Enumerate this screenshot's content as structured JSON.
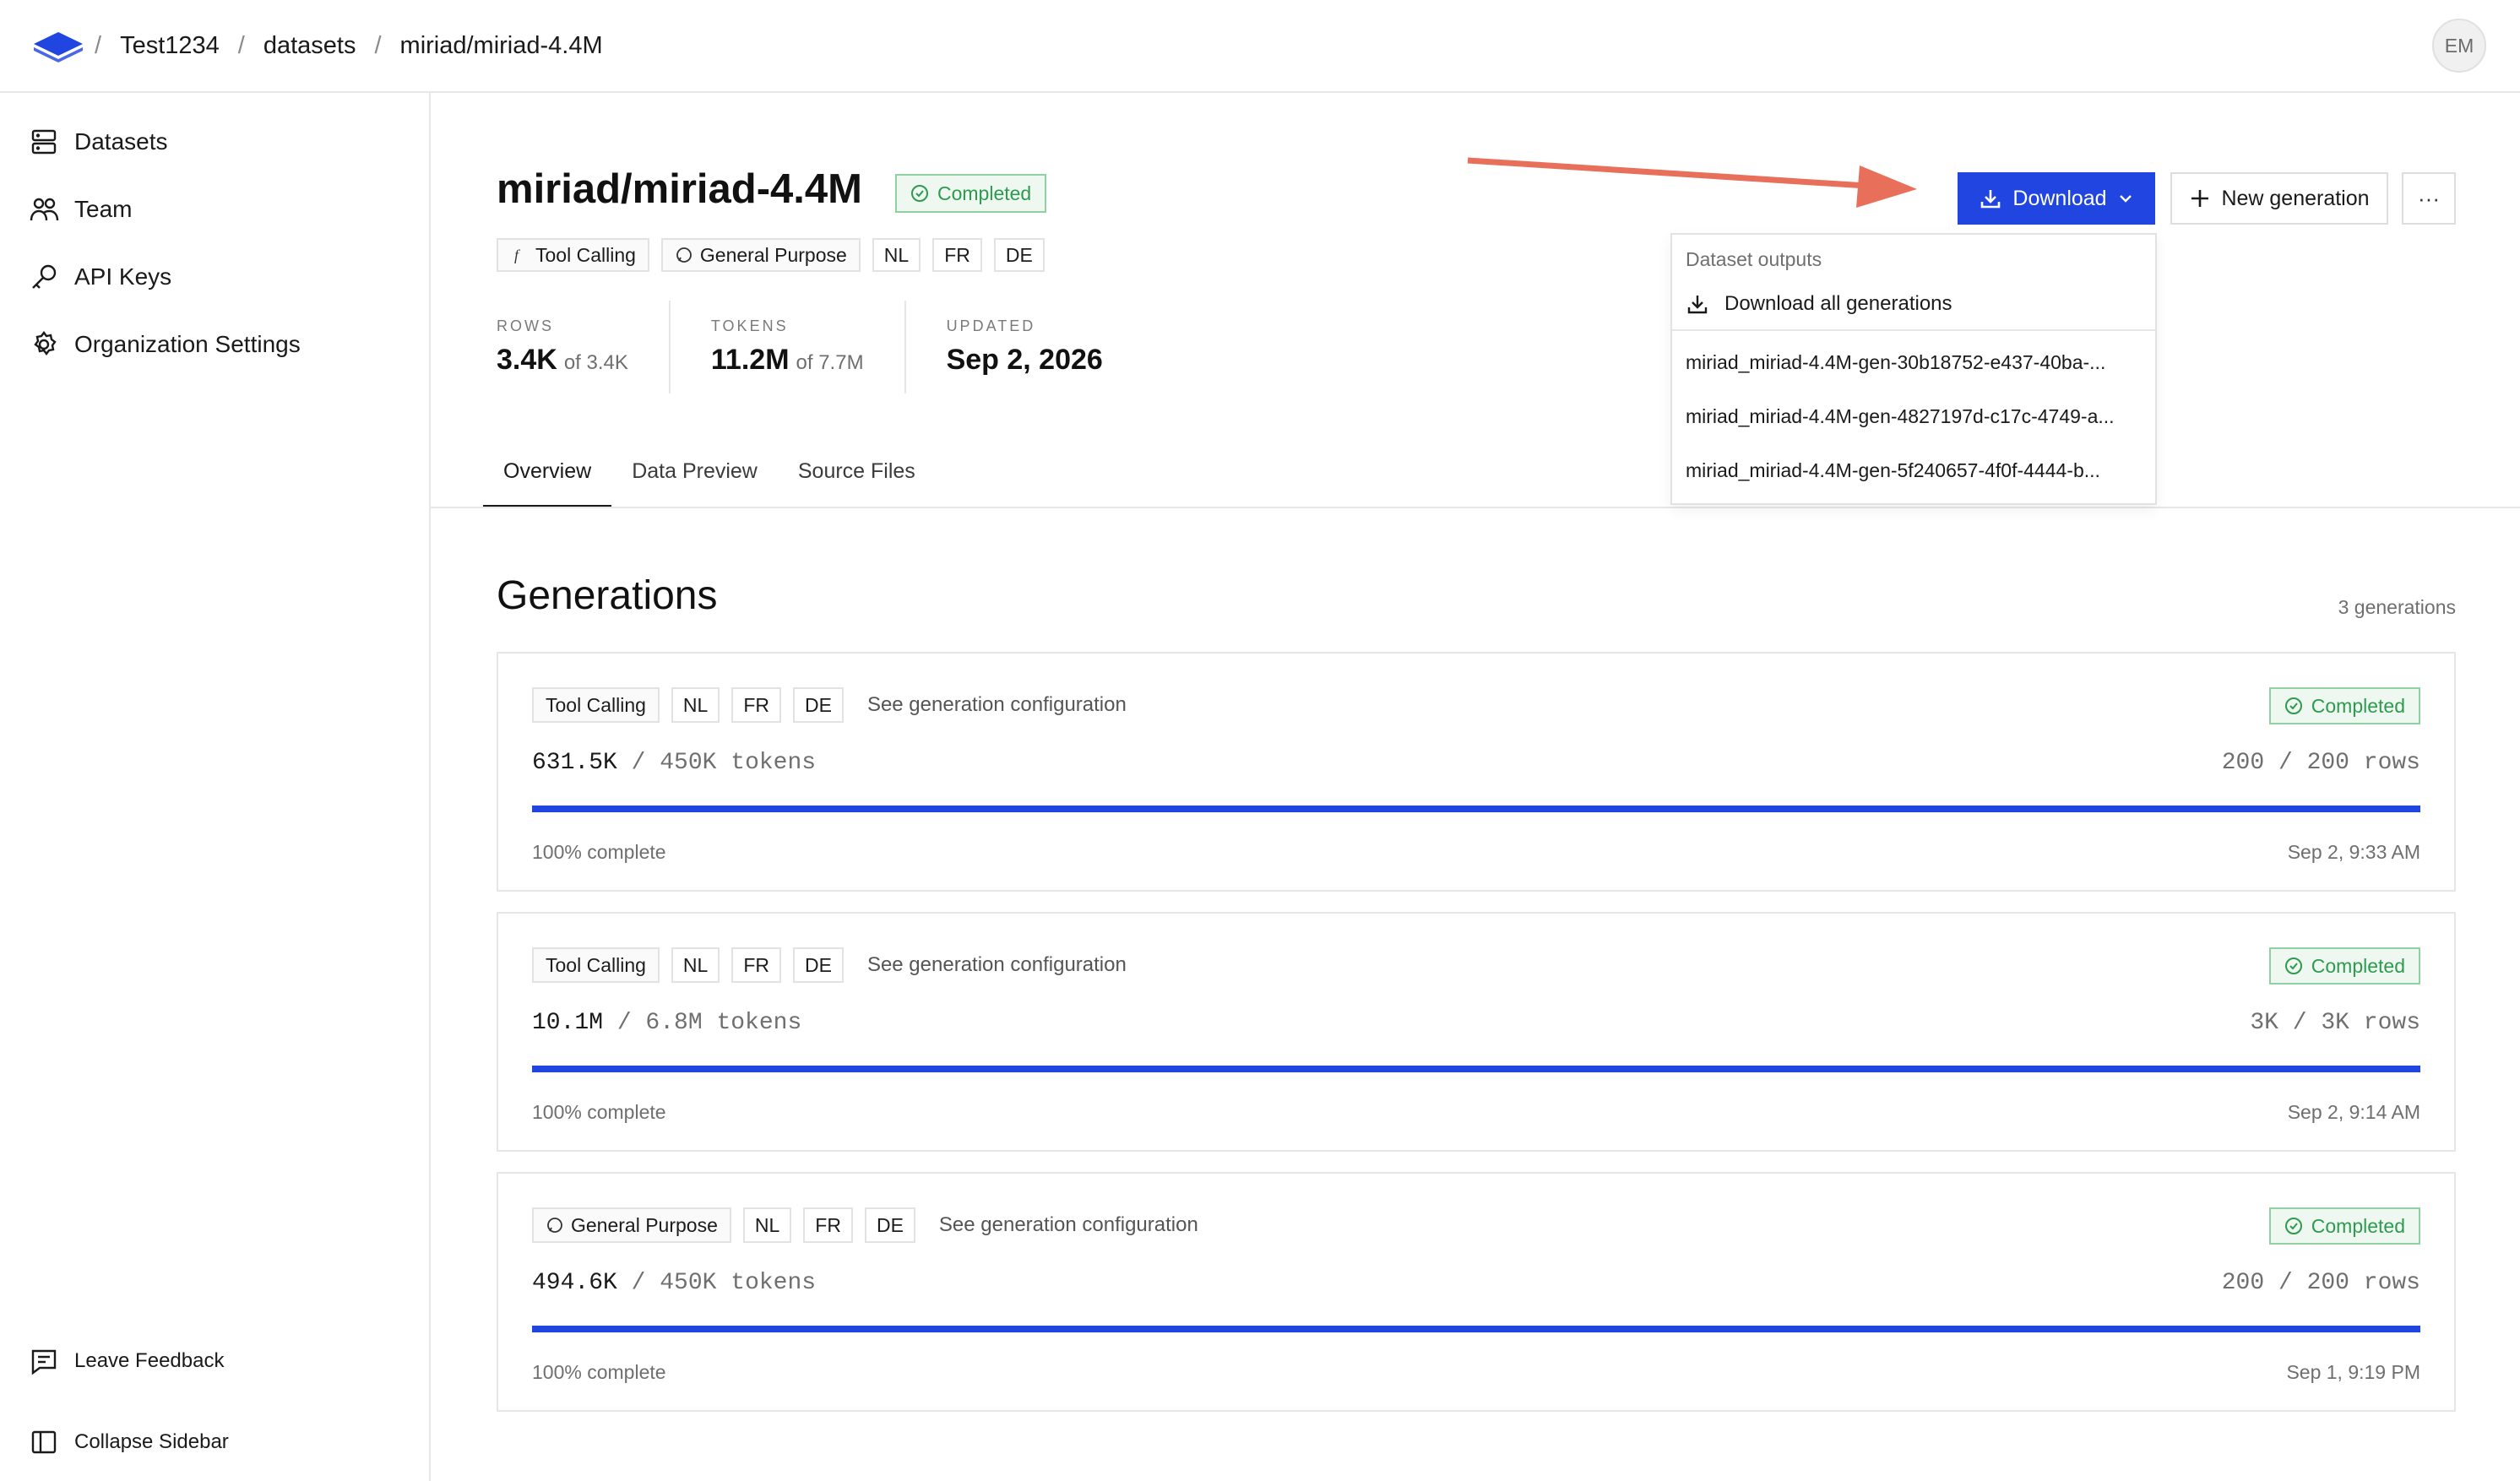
{
  "breadcrumb": [
    "Test1234",
    "datasets",
    "miriad/miriad-4.4M"
  ],
  "user": {
    "initials": "EM"
  },
  "sidebar": {
    "items": [
      {
        "label": "Datasets",
        "icon": "database-icon"
      },
      {
        "label": "Team",
        "icon": "team-icon"
      },
      {
        "label": "API Keys",
        "icon": "key-icon"
      },
      {
        "label": "Organization Settings",
        "icon": "gear-icon"
      }
    ],
    "footer": [
      {
        "label": "Leave Feedback",
        "icon": "feedback-icon"
      },
      {
        "label": "Collapse Sidebar",
        "icon": "sidebar-icon"
      }
    ]
  },
  "dataset": {
    "title": "miriad/miriad-4.4M",
    "status": "Completed",
    "tags": [
      "Tool Calling",
      "General Purpose"
    ],
    "languages": [
      "NL",
      "FR",
      "DE"
    ],
    "stats": [
      {
        "label": "ROWS",
        "value": "3.4K",
        "of": "of 3.4K"
      },
      {
        "label": "TOKENS",
        "value": "11.2M",
        "of": "of 7.7M"
      },
      {
        "label": "UPDATED",
        "value": "Sep 2, 2026"
      }
    ]
  },
  "tabs": [
    "Overview",
    "Data Preview",
    "Source Files"
  ],
  "actions": {
    "download": "Download",
    "new_generation": "New generation",
    "more": "···"
  },
  "dropdown": {
    "heading": "Dataset outputs",
    "download_all": "Download all generations",
    "items": [
      "miriad_miriad-4.4M-gen-30b18752-e437-40ba-...",
      "miriad_miriad-4.4M-gen-4827197d-c17c-4749-a...",
      "miriad_miriad-4.4M-gen-5f240657-4f0f-4444-b..."
    ]
  },
  "generations": {
    "title": "Generations",
    "count": "3 generations",
    "config_link": "See generation configuration",
    "items": [
      {
        "tag": "Tool Calling",
        "tag_icon": "",
        "languages": [
          "NL",
          "FR",
          "DE"
        ],
        "status": "Completed",
        "tokens": "631.5K",
        "tokens_total": "/ 450K tokens",
        "rows": "200 / 200 rows",
        "progress_pct": 100,
        "progress": "100% complete",
        "time": "Sep 2, 9:33 AM"
      },
      {
        "tag": "Tool Calling",
        "tag_icon": "",
        "languages": [
          "NL",
          "FR",
          "DE"
        ],
        "status": "Completed",
        "tokens": "10.1M",
        "tokens_total": "/ 6.8M tokens",
        "rows": "3K / 3K rows",
        "progress_pct": 100,
        "progress": "100% complete",
        "time": "Sep 2, 9:14 AM"
      },
      {
        "tag": "General Purpose",
        "tag_icon": "chat-bubble-icon",
        "languages": [
          "NL",
          "FR",
          "DE"
        ],
        "status": "Completed",
        "tokens": "494.6K",
        "tokens_total": "/ 450K tokens",
        "rows": "200 / 200 rows",
        "progress_pct": 100,
        "progress": "100% complete",
        "time": "Sep 1, 9:19 PM"
      }
    ]
  },
  "colors": {
    "accent": "#2145e0",
    "success": "#2e9a4f",
    "annotation_arrow": "#e8705a"
  }
}
